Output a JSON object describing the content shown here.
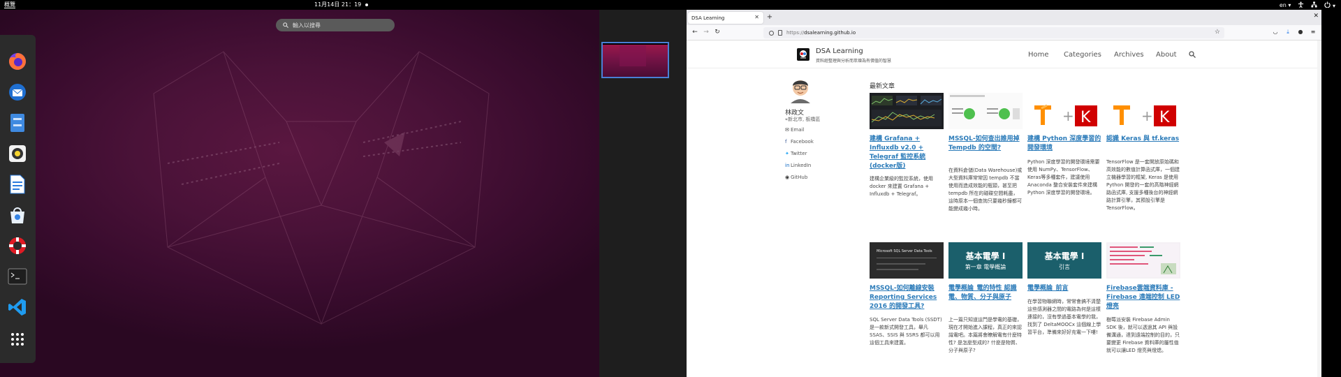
{
  "topbar": {
    "activities": "概覽",
    "clock": "11月14日 21：19",
    "lang": "en"
  },
  "overview": {
    "search_placeholder": "輸入以搜尋"
  },
  "dock": {
    "apps": [
      "firefox-icon",
      "thunderbird-icon",
      "files-icon",
      "rhythmbox-icon",
      "libreoffice-writer-icon",
      "software-icon",
      "help-icon",
      "terminal-icon",
      "vscode-icon",
      "show-apps-icon"
    ]
  },
  "browser": {
    "tab_title": "DSA Learning",
    "url_proto": "https://",
    "url_host": "dsalearning.github.io"
  },
  "site": {
    "title": "DSA Learning",
    "subtitle": "資料經整理與分析而萃煉為有價值的智慧",
    "nav": [
      "Home",
      "Categories",
      "Archives",
      "About"
    ],
    "author": "林政文",
    "location": "新北市, 板橋區",
    "social": [
      "Email",
      "Facebook",
      "Twitter",
      "LinkedIn",
      "GitHub"
    ],
    "recent_heading": "最新文章",
    "posts": [
      {
        "title": "建構 Grafana + Influxdb v2.0 + Telegraf 監控系統 (docker版)",
        "desc": "建構企業級的監控系統，使用 docker 來建置 Grafana + Influxdb + Telegraf。"
      },
      {
        "title": "MSSQL-如何查出誰用掉 Tempdb 的空間?",
        "desc": "在資料倉儲(Data Warehouse)或大型資料庫常常因 tempdb 不當使用而造成效能的瓶頸，甚至把 tempdb 所在的磁碟空間耗盡，這時原本一個查詢只要幾秒鐘都可能變成幾小時。"
      },
      {
        "title": "建構 Python 深度學習的開發環境",
        "desc": "Python 深度學習的開發環境需要使用 NumPy、TensorFlow、Keras等多種套件，建議使用 Anaconda 整合安裝套件來建構 Python 深度學習的開發環境。",
        "thumb_left": "T",
        "thumb_right": "K"
      },
      {
        "title": "認識 Keras 與 tf.keras",
        "desc": "TensorFlow 是一套開放原始碼和高效能的數值計算函式庫，一個建立機器學習的框架, Keras 是使用 Python 開發的一套的高階神經網路函式庫, 支援多種後台的神經網路計算引擎，其預設引擎是 TensorFlow。",
        "thumb_left": "T",
        "thumb_right": "K"
      },
      {
        "title": "MSSQL-如何離線安裝 Reporting Services 2016 的開發工具?",
        "desc": "SQL Server Data Tools (SSDT) 是一款新式開發工具，舉凡 SSAS、SSIS 與 SSRS 都可以用這個工具來建置。",
        "thumb_text": "Microsoft SQL Server Data Tools"
      },
      {
        "title": "電學概論_電的特性 認識電、物質、分子與原子",
        "desc": "上一篇只知道這門是學電的基礎，現在才開始進入課程，真正的來認識電吧。本篇將會瞭解電有什麼特性? 是怎麼型成的? 什麼是物質、分子與原子?",
        "thumb_line1": "基本電學 I",
        "thumb_line2": "第一章 電學概論"
      },
      {
        "title": "電學概論_前言",
        "desc": "在學習物聯網時，常常會搞不清楚這些感測器之間的電路為何是這樣連接的，沒有學過基本電學的我，找到了 DeltaMOOCx 這個線上學習平台，準備來好好充電一下嘍!",
        "thumb_line1": "基本電學 I",
        "thumb_line2": "引言"
      },
      {
        "title": "Firebase雲端資料庫 - Firebase 遠端控制 LED燈亮",
        "desc": "樹莓派安裝 Firebase Admin SDK 後，就可以透過其 API 與設備溝通，達到遠端控制的目的，只要變更 Firebase 資料庫的屬性值就可以讓LED 燈亮與燈熄。"
      }
    ]
  }
}
